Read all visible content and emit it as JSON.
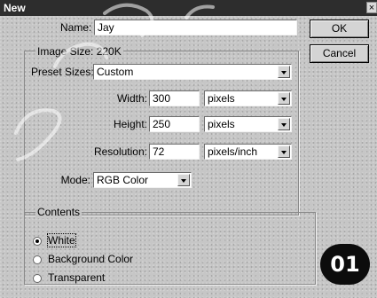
{
  "window": {
    "title": "New",
    "close_glyph": "×"
  },
  "form": {
    "name_label": "Name:",
    "name_value": "Jay",
    "image_size_label": "Image Size: 220K",
    "preset_label": "Preset Sizes:",
    "preset_value": "Custom",
    "width_label": "Width:",
    "width_value": "300",
    "width_unit": "pixels",
    "height_label": "Height:",
    "height_value": "250",
    "height_unit": "pixels",
    "resolution_label": "Resolution:",
    "resolution_value": "72",
    "resolution_unit": "pixels/inch",
    "mode_label": "Mode:",
    "mode_value": "RGB Color"
  },
  "contents": {
    "title": "Contents",
    "options": [
      "White",
      "Background Color",
      "Transparent"
    ],
    "selected": "White"
  },
  "buttons": {
    "ok": "OK",
    "cancel": "Cancel"
  },
  "badge": "01",
  "icons": {
    "close": "close-icon",
    "dropdown": "chevron-down-icon"
  }
}
